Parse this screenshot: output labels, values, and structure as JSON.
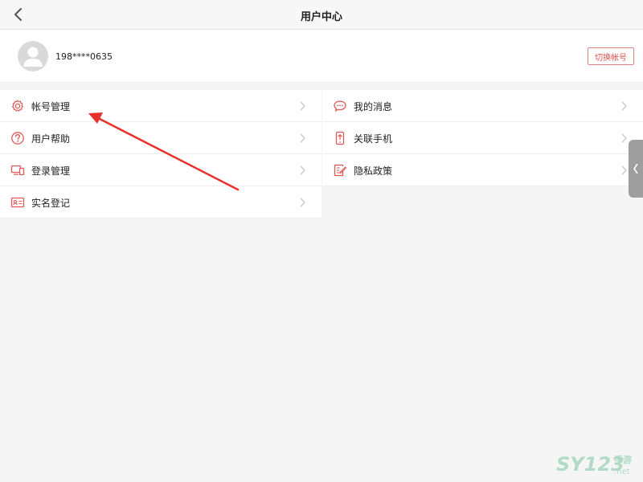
{
  "header": {
    "title": "用户中心",
    "back_icon": "chevron-left-icon"
  },
  "account": {
    "phone": "198****0635",
    "switch_label": "切换帐号"
  },
  "menu_left": [
    {
      "label": "帐号管理",
      "icon": "gear-icon"
    },
    {
      "label": "用户帮助",
      "icon": "help-circle-icon"
    },
    {
      "label": "登录管理",
      "icon": "devices-icon"
    },
    {
      "label": "实名登记",
      "icon": "id-card-icon"
    }
  ],
  "menu_right": [
    {
      "label": "我的消息",
      "icon": "chat-bubble-icon"
    },
    {
      "label": "关联手机",
      "icon": "phone-link-icon"
    },
    {
      "label": "隐私政策",
      "icon": "policy-edit-icon"
    }
  ],
  "colors": {
    "accent_red": "#d9534f",
    "icon_red": "#e05a55",
    "background": "#f5f5f5"
  },
  "watermark": {
    "text": "SY123手游 .net"
  }
}
